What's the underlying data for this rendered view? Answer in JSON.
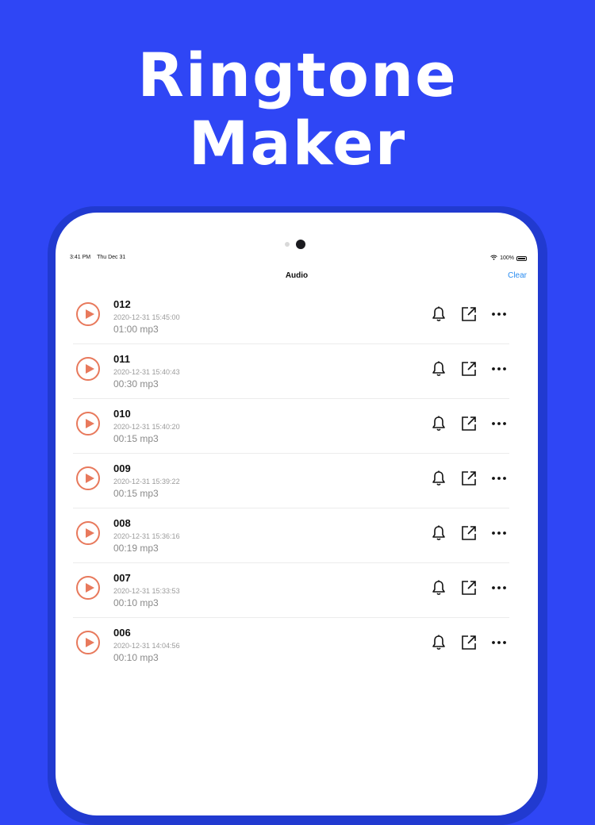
{
  "promo": {
    "title_line1": "Ringtone",
    "title_line2": "Maker",
    "background_color": "#2f46f5"
  },
  "status_bar": {
    "time": "3:41 PM",
    "date": "Thu Dec 31",
    "battery": "100%"
  },
  "nav": {
    "title": "Audio",
    "clear_label": "Clear"
  },
  "icons": {
    "play": "play-icon",
    "ringtone": "bell-icon",
    "share": "share-icon",
    "more": "more-icon"
  },
  "audio_items": [
    {
      "name": "012",
      "date": "2020-12-31 15:45:00",
      "meta": "01:00 mp3"
    },
    {
      "name": "011",
      "date": "2020-12-31 15:40:43",
      "meta": "00:30 mp3"
    },
    {
      "name": "010",
      "date": "2020-12-31 15:40:20",
      "meta": "00:15 mp3"
    },
    {
      "name": "009",
      "date": "2020-12-31 15:39:22",
      "meta": "00:15 mp3"
    },
    {
      "name": "008",
      "date": "2020-12-31 15:36:16",
      "meta": "00:19 mp3"
    },
    {
      "name": "007",
      "date": "2020-12-31 15:33:53",
      "meta": "00:10 mp3"
    },
    {
      "name": "006",
      "date": "2020-12-31 14:04:56",
      "meta": "00:10 mp3"
    }
  ]
}
